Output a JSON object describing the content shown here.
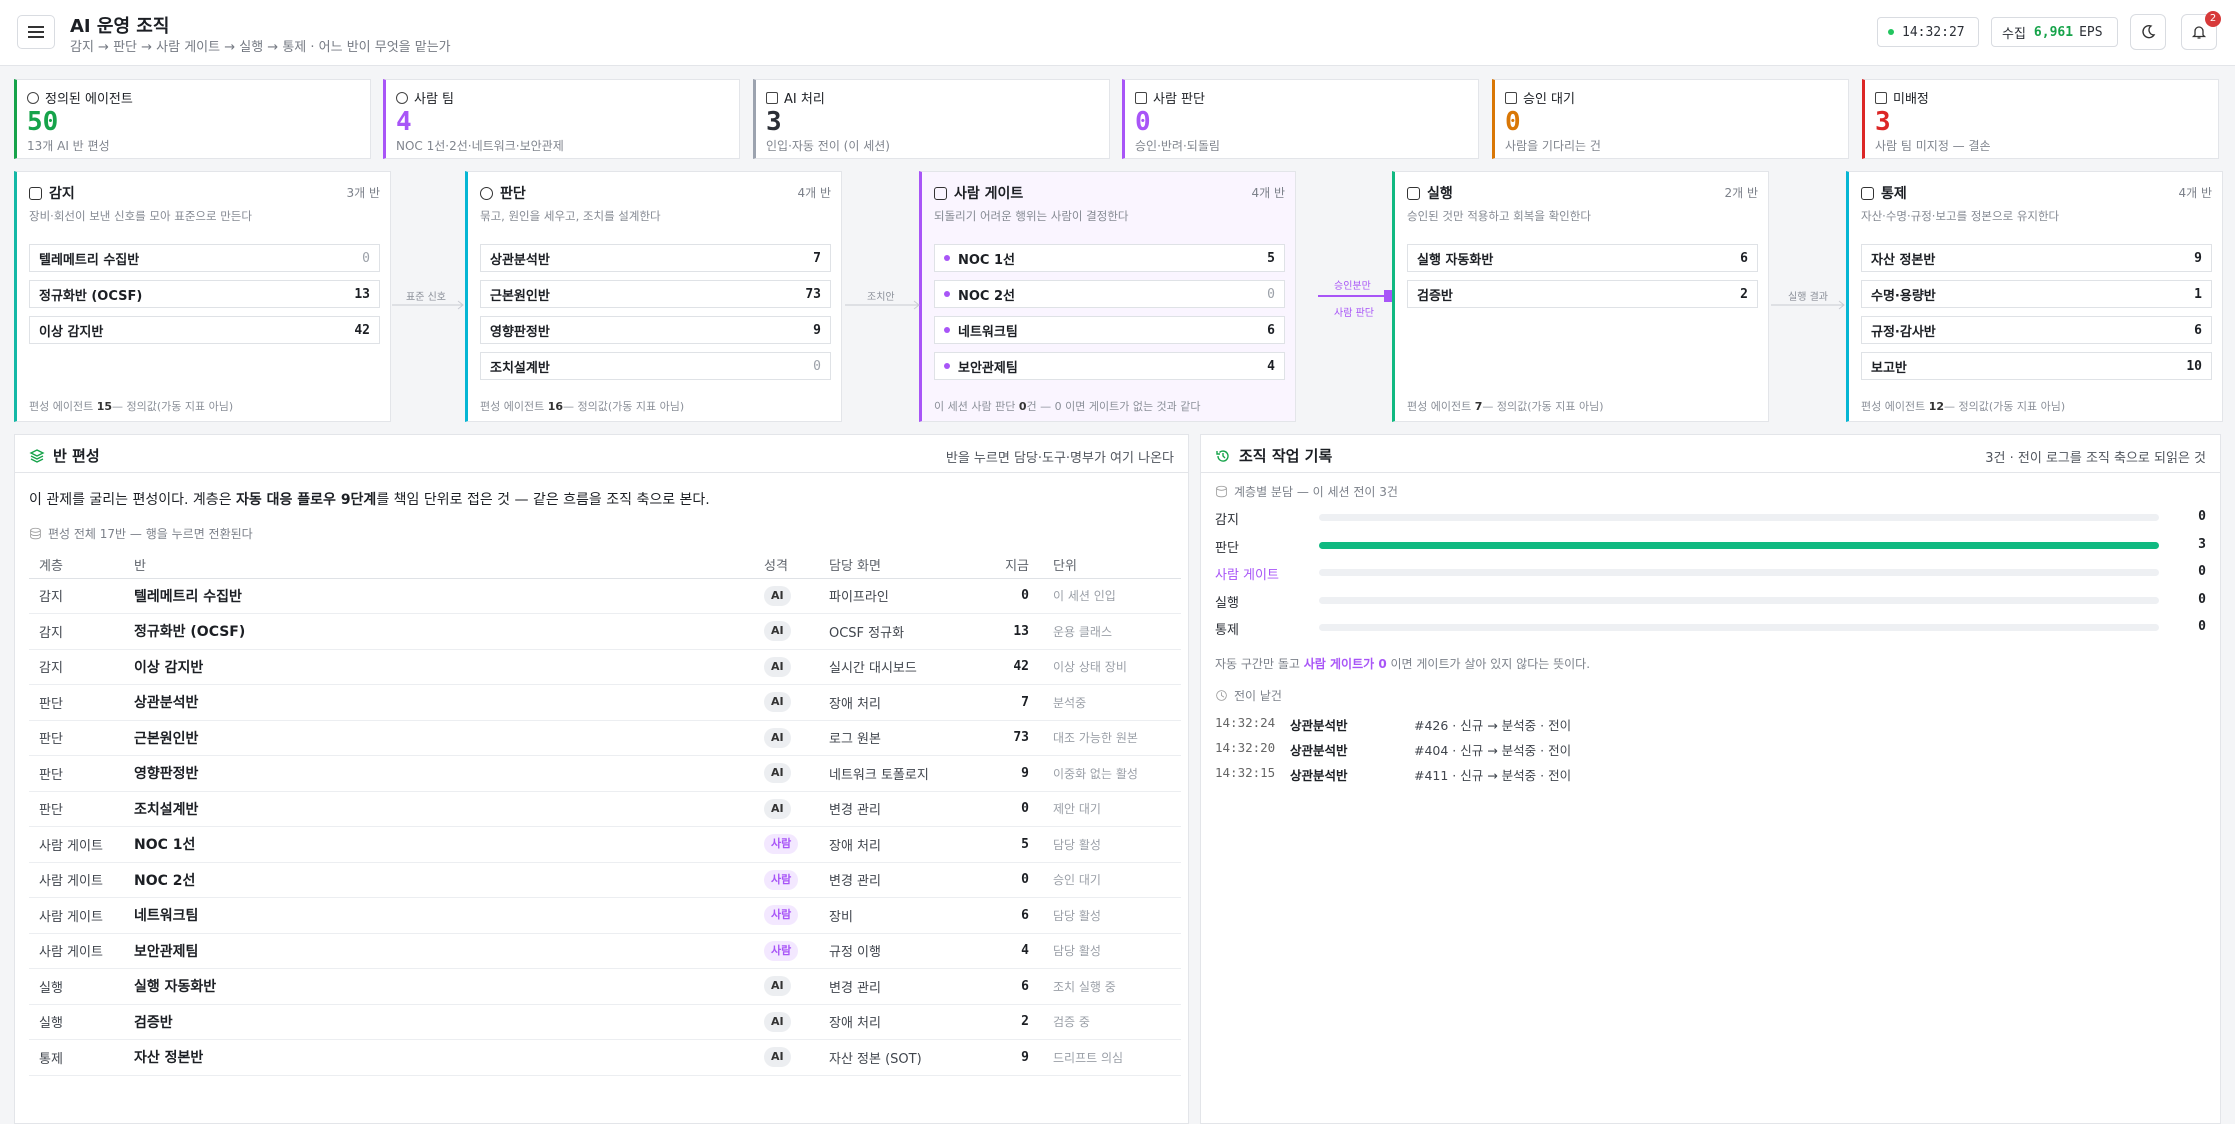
{
  "header": {
    "title": "AI 운영 조직",
    "subtitle": "감지 → 판단 → 사람 게이트 → 실행 → 통제 · 어느 반이 무엇을 맡는가",
    "clock": "14:32:27",
    "ingest_label": "수집",
    "ingest_value": "6,961",
    "ingest_unit": "EPS",
    "notifications": "2"
  },
  "stats": [
    {
      "label": "정의된 에이전트",
      "value": "50",
      "desc": "13개 AI 반 편성",
      "color": "#16a34a"
    },
    {
      "label": "사람 팀",
      "value": "4",
      "desc": "NOC 1선·2선·네트워크·보안관제",
      "color": "#a855f7"
    },
    {
      "label": "AI 처리",
      "value": "3",
      "desc": "인입·자동 전이 (이 세션)",
      "color": "#9ca3af"
    },
    {
      "label": "사람 판단",
      "value": "0",
      "desc": "승인·반려·되돌림",
      "color": "#a855f7"
    },
    {
      "label": "승인 대기",
      "value": "0",
      "desc": "사람을 기다리는 건",
      "color": "#d97706"
    },
    {
      "label": "미배정",
      "value": "3",
      "desc": "사람 팀 미지정 — 결손",
      "color": "#dc2626"
    }
  ],
  "stages": [
    {
      "name": "감지",
      "count": "3개 반",
      "desc": "장비·회선이 보낸 신호를 모아 표준으로 만든다",
      "color": "#14b8a6",
      "units": [
        {
          "name": "텔레메트리 수집반",
          "value": "0"
        },
        {
          "name": "정규화반 (OCSF)",
          "value": "13"
        },
        {
          "name": "이상 감지반",
          "value": "42"
        }
      ],
      "footer_a": "편성 에이전트",
      "footer_n": "15",
      "footer_b": "— 정의값(가동 지표 아님)"
    },
    {
      "name": "판단",
      "count": "4개 반",
      "desc": "묶고, 원인을 세우고, 조치를 설계한다",
      "color": "#06b6d4",
      "units": [
        {
          "name": "상관분석반",
          "value": "7"
        },
        {
          "name": "근본원인반",
          "value": "73"
        },
        {
          "name": "영향판정반",
          "value": "9"
        },
        {
          "name": "조치설계반",
          "value": "0"
        }
      ],
      "footer_a": "편성 에이전트",
      "footer_n": "16",
      "footer_b": "— 정의값(가동 지표 아님)"
    },
    {
      "name": "사람 게이트",
      "count": "4개 반",
      "desc": "되돌리기 어려운 행위는 사람이 결정한다",
      "color": "#a855f7",
      "units": [
        {
          "name": "NOC 1선",
          "value": "5"
        },
        {
          "name": "NOC 2선",
          "value": "0"
        },
        {
          "name": "네트워크팀",
          "value": "6"
        },
        {
          "name": "보안관제팀",
          "value": "4"
        }
      ],
      "footer_a": "이 세션 사람 판단",
      "footer_n": "0",
      "footer_b": "건 — 0 이면 게이트가 없는 것과 같다"
    },
    {
      "name": "실행",
      "count": "2개 반",
      "desc": "승인된 것만 적용하고 회복을 확인한다",
      "color": "#10b981",
      "units": [
        {
          "name": "실행 자동화반",
          "value": "6"
        },
        {
          "name": "검증반",
          "value": "2"
        }
      ],
      "footer_a": "편성 에이전트",
      "footer_n": "7",
      "footer_b": "— 정의값(가동 지표 아님)"
    },
    {
      "name": "통제",
      "count": "4개 반",
      "desc": "자산·수명·규정·보고를 정본으로 유지한다",
      "color": "#06b6d4",
      "units": [
        {
          "name": "자산 정본반",
          "value": "9"
        },
        {
          "name": "수명·용량반",
          "value": "1"
        },
        {
          "name": "규정·감사반",
          "value": "6"
        },
        {
          "name": "보고반",
          "value": "10"
        }
      ],
      "footer_a": "편성 에이전트",
      "footer_n": "12",
      "footer_b": "— 정의값(가동 지표 아님)"
    }
  ],
  "connectors": [
    "표준 신호",
    "조치안",
    "승인분만",
    "사람 판단",
    "실행 결과"
  ],
  "roster": {
    "title": "반 편성",
    "hint": "반을 누르면 담당·도구·명부가 여기 나온다",
    "intro_a": "이 관제를 굴리는 편성이다. 계층은 ",
    "intro_b": "자동 대응 플로우 9단계",
    "intro_c": "를 책임 단위로 접은 것 — 같은 흐름을 조직 축으로 본다.",
    "sub": "편성 전체 17반 — 행을 누르면 전환된다",
    "columns": [
      "계층",
      "반",
      "성격",
      "담당 화면",
      "지금",
      "단위"
    ],
    "rows": [
      [
        "감지",
        "텔레메트리 수집반",
        "AI",
        "파이프라인",
        "0",
        "이 세션 인입"
      ],
      [
        "감지",
        "정규화반 (OCSF)",
        "AI",
        "OCSF 정규화",
        "13",
        "운용 클래스"
      ],
      [
        "감지",
        "이상 감지반",
        "AI",
        "실시간 대시보드",
        "42",
        "이상 상태 장비"
      ],
      [
        "판단",
        "상관분석반",
        "AI",
        "장애 처리",
        "7",
        "분석중"
      ],
      [
        "판단",
        "근본원인반",
        "AI",
        "로그 원본",
        "73",
        "대조 가능한 원본"
      ],
      [
        "판단",
        "영향판정반",
        "AI",
        "네트워크 토폴로지",
        "9",
        "이중화 없는 활성"
      ],
      [
        "판단",
        "조치설계반",
        "AI",
        "변경 관리",
        "0",
        "제안 대기"
      ],
      [
        "사람 게이트",
        "NOC 1선",
        "사람",
        "장애 처리",
        "5",
        "담당 활성"
      ],
      [
        "사람 게이트",
        "NOC 2선",
        "사람",
        "변경 관리",
        "0",
        "승인 대기"
      ],
      [
        "사람 게이트",
        "네트워크팀",
        "사람",
        "장비",
        "6",
        "담당 활성"
      ],
      [
        "사람 게이트",
        "보안관제팀",
        "사람",
        "규정 이행",
        "4",
        "담당 활성"
      ],
      [
        "실행",
        "실행 자동화반",
        "AI",
        "변경 관리",
        "6",
        "조치 실행 중"
      ],
      [
        "실행",
        "검증반",
        "AI",
        "장애 처리",
        "2",
        "검증 중"
      ],
      [
        "통제",
        "자산 정본반",
        "AI",
        "자산 정본 (SOT)",
        "9",
        "드리프트 의심"
      ]
    ]
  },
  "log": {
    "title": "조직 작업 기록",
    "hint": "3건 · 전이 로그를 조직 축으로 되읽은 것",
    "dist_title": "계층별 분담 — 이 세션 전이 3건",
    "dist": [
      {
        "label": "감지",
        "value": 3,
        "shown": "0",
        "max": 3
      },
      {
        "label": "판단",
        "value": 3,
        "shown": "3",
        "max": 3
      },
      {
        "label": "사람 게이트",
        "value": 0,
        "shown": "0",
        "max": 3
      },
      {
        "label": "실행",
        "value": 0,
        "shown": "0",
        "max": 3
      },
      {
        "label": "통제",
        "value": 0,
        "shown": "0",
        "max": 3
      }
    ],
    "note_a": "자동 구간만 돌고 ",
    "note_b": "사람 게이트가 0",
    "note_c": " 이면 게이트가 살아 있지 않다는 뜻이다.",
    "recent_title": "전이 낱건",
    "entries": [
      {
        "time": "14:32:24",
        "unit": "상관분석반",
        "text": "#426 · 신규 → 분석중 · 전이"
      },
      {
        "time": "14:32:20",
        "unit": "상관분석반",
        "text": "#404 · 신규 → 분석중 · 전이"
      },
      {
        "time": "14:32:15",
        "unit": "상관분석반",
        "text": "#411 · 신규 → 분석중 · 전이"
      }
    ]
  }
}
